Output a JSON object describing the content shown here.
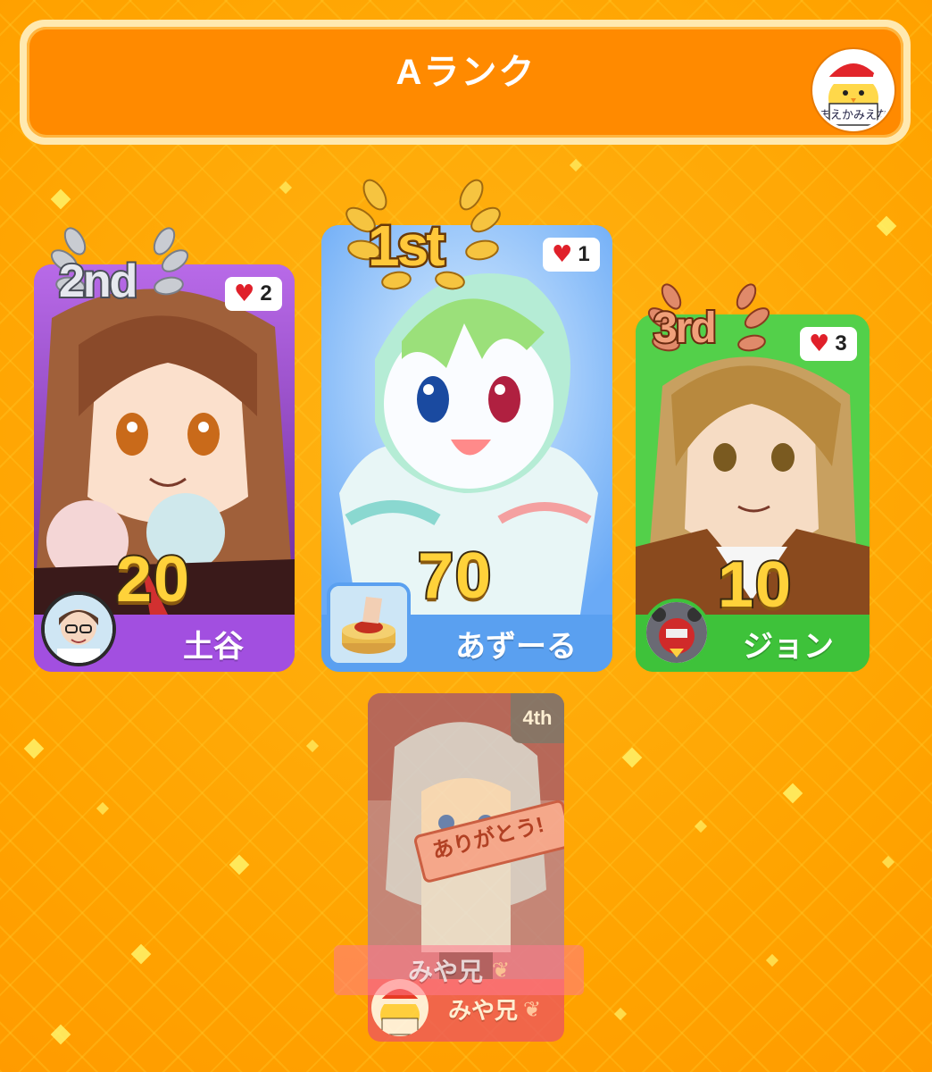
{
  "header": {
    "title": "Aランク",
    "avatar_text": "まえかみえな"
  },
  "players": [
    {
      "rank_label": "2nd",
      "likes": "2",
      "score": "20",
      "name": "土谷",
      "color": "#a24fe0"
    },
    {
      "rank_label": "1st",
      "likes": "1",
      "score": "70",
      "name": "あずーる",
      "color": "#5aa0f0"
    },
    {
      "rank_label": "3rd",
      "likes": "3",
      "score": "10",
      "name": "ジョン",
      "color": "#3ec23a"
    }
  ],
  "fourth": {
    "rank_label": "4th",
    "sign_text": "ありがとう!",
    "name_ghost": "みや兄",
    "name": "みや兄",
    "avatar_text": "まえかみえな"
  }
}
